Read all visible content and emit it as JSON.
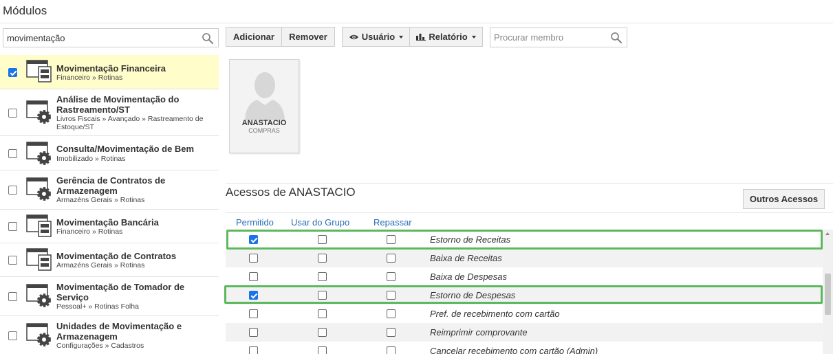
{
  "page": {
    "title": "Módulos"
  },
  "left_search": {
    "value": "movimentação"
  },
  "modules": [
    {
      "name": "Movimentação Financeira",
      "path": "Financeiro » Rotinas",
      "checked": true,
      "icon": "window-table-icon"
    },
    {
      "name": "Análise de Movimentação do Rastreamento/ST",
      "path": "Livros Fiscais » Avançado » Rastreamento de Estoque/ST",
      "checked": false,
      "icon": "window-gear-icon"
    },
    {
      "name": "Consulta/Movimentação de Bem",
      "path": "Imobilizado » Rotinas",
      "checked": false,
      "icon": "window-gear-icon"
    },
    {
      "name": "Gerência de Contratos de Armazenagem",
      "path": "Armazéns Gerais » Rotinas",
      "checked": false,
      "icon": "window-gear-icon"
    },
    {
      "name": "Movimentação Bancária",
      "path": "Financeiro » Rotinas",
      "checked": false,
      "icon": "window-table-icon"
    },
    {
      "name": "Movimentação de Contratos",
      "path": "Armazéns Gerais » Rotinas",
      "checked": false,
      "icon": "window-table-icon"
    },
    {
      "name": "Movimentação de Tomador de Serviço",
      "path": "Pessoal+ » Rotinas Folha",
      "checked": false,
      "icon": "window-gear-icon"
    },
    {
      "name": "Unidades de Movimentação e Armazenagem",
      "path": "Configurações » Cadastros",
      "checked": false,
      "icon": "window-gear-icon"
    }
  ],
  "toolbar": {
    "add_label": "Adicionar",
    "remove_label": "Remover",
    "user_label": "Usuário",
    "report_label": "Relatório",
    "member_search_placeholder": "Procurar membro"
  },
  "member": {
    "name": "ANASTACIO",
    "department": "COMPRAS"
  },
  "access": {
    "title": "Acessos de ANASTACIO",
    "other_label": "Outros Acessos",
    "columns": [
      "Permitido",
      "Usar do Grupo",
      "Repassar"
    ],
    "rows": [
      {
        "label": "Estorno de Receitas",
        "permitido": true,
        "grupo": false,
        "repassar": false,
        "highlighted": true
      },
      {
        "label": "Baixa de Receitas",
        "permitido": false,
        "grupo": false,
        "repassar": false,
        "highlighted": false
      },
      {
        "label": "Baixa de Despesas",
        "permitido": false,
        "grupo": false,
        "repassar": false,
        "highlighted": false
      },
      {
        "label": "Estorno de Despesas",
        "permitido": true,
        "grupo": false,
        "repassar": false,
        "highlighted": true
      },
      {
        "label": "Pref. de recebimento com cartão",
        "permitido": false,
        "grupo": false,
        "repassar": false,
        "highlighted": false
      },
      {
        "label": "Reimprimir comprovante",
        "permitido": false,
        "grupo": false,
        "repassar": false,
        "highlighted": false
      },
      {
        "label": "Cancelar recebimento com cartão (Admin)",
        "permitido": false,
        "grupo": false,
        "repassar": false,
        "highlighted": false
      }
    ]
  },
  "colors": {
    "accent": "#1a73e8",
    "highlight_border": "#5cb85c",
    "selected_row": "#fffdc9",
    "column_header": "#2a6db5"
  }
}
